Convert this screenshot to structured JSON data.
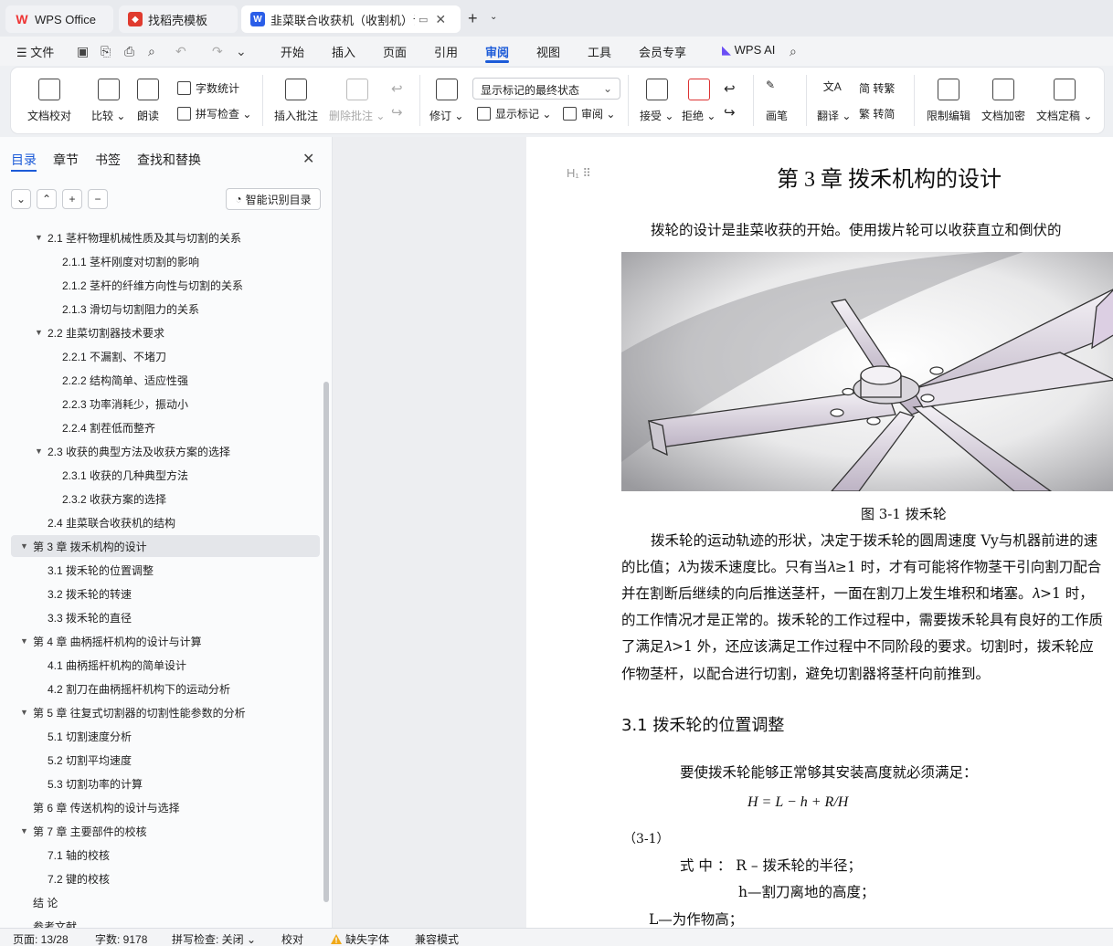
{
  "tabs": [
    {
      "label": "WPS Office"
    },
    {
      "label": "找稻壳模板"
    },
    {
      "label": "韭菜联合收获机（收割机）设计"
    }
  ],
  "menu": {
    "file": "文件",
    "items": [
      "开始",
      "插入",
      "页面",
      "引用",
      "审阅",
      "视图",
      "工具",
      "会员专享"
    ],
    "active": "审阅",
    "ai": "WPS AI"
  },
  "ribbon": {
    "doc_check": "文档校对",
    "compare": "比较",
    "read_aloud": "朗读",
    "word_count": "字数统计",
    "spell_check": "拼写检查",
    "insert_comment": "插入批注",
    "delete_comment": "删除批注",
    "revise": "修订",
    "markup_state": "显示标记的最终状态",
    "show_markup": "显示标记",
    "review_pane": "审阅",
    "accept": "接受",
    "reject": "拒绝",
    "pen": "画笔",
    "translate": "翻译",
    "to_traditional": "简 转繁",
    "to_simplified": "繁 转简",
    "restrict_edit": "限制编辑",
    "encrypt": "文档加密",
    "finalize": "文档定稿"
  },
  "leftpanel": {
    "tabs": [
      "目录",
      "章节",
      "书签",
      "查找和替换"
    ],
    "smart_button": "智能识别目录",
    "toc": [
      {
        "text": "2.1 茎杆物理机械性质及其与切割的关系",
        "level": 2,
        "expanded": true
      },
      {
        "text": "2.1.1 茎杆刚度对切割的影响",
        "level": 3
      },
      {
        "text": "2.1.2 茎杆的纤维方向性与切割的关系",
        "level": 3
      },
      {
        "text": "2.1.3 滑切与切割阻力的关系",
        "level": 3
      },
      {
        "text": "2.2 韭菜切割器技术要求",
        "level": 2,
        "expanded": true
      },
      {
        "text": "2.2.1 不漏割、不堵刀",
        "level": 3
      },
      {
        "text": "2.2.2 结构简单、适应性强",
        "level": 3
      },
      {
        "text": "2.2.3 功率消耗少，振动小",
        "level": 3
      },
      {
        "text": "2.2.4 割茬低而整齐",
        "level": 3
      },
      {
        "text": "2.3 收获的典型方法及收获方案的选择",
        "level": 2,
        "expanded": true
      },
      {
        "text": "2.3.1 收获的几种典型方法",
        "level": 3
      },
      {
        "text": "2.3.2 收获方案的选择",
        "level": 3
      },
      {
        "text": "2.4 韭菜联合收获机的结构",
        "level": 2
      },
      {
        "text": "第 3 章  拨禾机构的设计",
        "level": 1,
        "expanded": true,
        "selected": true
      },
      {
        "text": "3.1 拨禾轮的位置调整",
        "level": 2
      },
      {
        "text": "3.2 拨禾轮的转速",
        "level": 2
      },
      {
        "text": "3.3  拨禾轮的直径",
        "level": 2
      },
      {
        "text": "第 4 章  曲柄摇杆机构的设计与计算",
        "level": 1,
        "expanded": true
      },
      {
        "text": "4.1 曲柄摇杆机构的简单设计",
        "level": 2
      },
      {
        "text": "4.2 割刀在曲柄摇杆机构下的运动分析",
        "level": 2
      },
      {
        "text": "第 5 章  往复式切割器的切割性能参数的分析",
        "level": 1,
        "expanded": true
      },
      {
        "text": "5.1 切割速度分析",
        "level": 2
      },
      {
        "text": "5.2 切割平均速度",
        "level": 2
      },
      {
        "text": "5.3 切割功率的计算",
        "level": 2
      },
      {
        "text": "第 6 章  传送机构的设计与选择",
        "level": 1
      },
      {
        "text": "第 7 章  主要部件的校核",
        "level": 1,
        "expanded": true
      },
      {
        "text": "7.1 轴的校核",
        "level": 2
      },
      {
        "text": "7.2 键的校核",
        "level": 2
      },
      {
        "text": "结    论",
        "level": 1
      },
      {
        "text": "参考文献",
        "level": 1
      }
    ]
  },
  "document": {
    "heading_marker": "H",
    "chapter_title": "第 3 章  拨禾机构的设计",
    "intro": "拨轮的设计是韭菜收获的开始。使用拨片轮可以收获直立和倒伏的",
    "figure_caption": "图 3-1  拨禾轮",
    "para_lines": [
      "拨禾轮的运动轨迹的形状，决定于拨禾轮的圆周速度 Vy与机器前进的速",
      "的比值；𝜆为拨禾速度比。只有当𝜆≥1 时，才有可能将作物茎干引向割刀配合",
      "并在割断后继续的向后推送茎杆，一面在割刀上发生堆积和堵塞。𝜆>1 时，",
      "的工作情况才是正常的。拨禾轮的工作过程中，需要拨禾轮具有良好的工作质",
      "了满足𝜆>1 外，还应该满足工作过程中不同阶段的要求。切割时，拨禾轮应",
      "作物茎杆，以配合进行切割，避免切割器将茎杆向前推到。"
    ],
    "section_title": "3.1 拨禾轮的位置调整",
    "section_text": "要使拨禾轮能够正常够其安装高度就必须满足：",
    "formula": "H = L − h + R/H",
    "eq_number": "（3-1）",
    "where_line1": "式 中 ：  R – 拨禾轮的半径；",
    "where_line2": "h—割刀离地的高度；",
    "where_line3": "L—为作物高；"
  },
  "status": {
    "page": "页面: 13/28",
    "words": "字数: 9178",
    "spell": "拼写检查: 关闭",
    "proof": "校对",
    "missing_font": "缺失字体",
    "compat": "兼容模式"
  },
  "colors": {
    "accent": "#1c5bd8",
    "wps_red": "#e33b2f"
  }
}
